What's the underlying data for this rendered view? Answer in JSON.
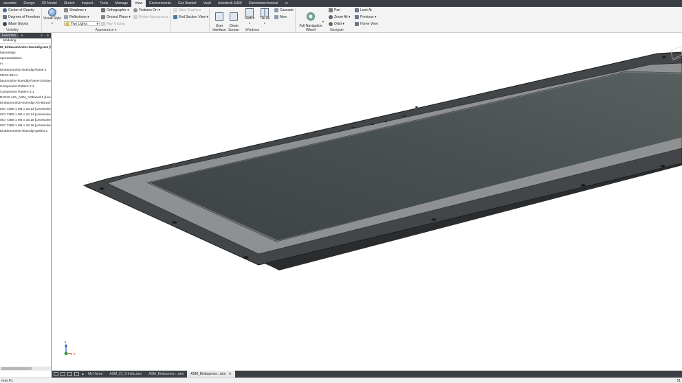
{
  "menu": {
    "tabs": [
      "ssemble",
      "Design",
      "3D Model",
      "Sketch",
      "Inspect",
      "Tools",
      "Manage",
      "View",
      "Environments",
      "Get Started",
      "Vault",
      "Autodesk A360",
      "Electromechanical",
      "▪▾"
    ],
    "active_index": 7
  },
  "ribbon": {
    "visibility": {
      "center_of_gravity": "Center of Gravity",
      "degrees_of_freedom": "Degrees of Freedom",
      "imate_glyphs": "iMate Glyphs",
      "label": "Visibility"
    },
    "appearance": {
      "visual_style": "Visual Style",
      "shadows": "Shadows",
      "reflections": "Reflections",
      "lighting": "Two Lights",
      "orthographic": "Orthographic",
      "ground_plane": "Ground Plane",
      "ray_tracing": "Ray Tracing",
      "textures_on": "Textures On",
      "refine_appearance": "Refine Appearance",
      "slice_graphics": "Slice Graphics",
      "end_section_view": "End Section View",
      "label": "Appearance ▾"
    },
    "windows": {
      "user_interface": "User\nInterface",
      "clean_screen": "Clean\nScreen",
      "switch": "Switch",
      "tile_all": "Tile All",
      "cascade": "Cascade",
      "new": "New",
      "label": "Windows"
    },
    "navigate": {
      "full_nav_wheel": "Full Navigation\nWheel",
      "pan": "Pan",
      "zoom_all": "Zoom All",
      "orbit": "Orbit",
      "look_at": "Look At",
      "previous": "Previous",
      "home_view": "Home View",
      "label": "Navigate"
    }
  },
  "browser": {
    "tab": "Favorites",
    "add": "+",
    "mode": "Modeling",
    "nodes": [
      "M_Einbaumonitor-buendig.iam [l",
      "lationships",
      "epresentations",
      "in",
      "Einbaumonitor-buendig-frame:1",
      "M215-B01:1",
      "baumonitor-buendig-frame-Gehaeuse:",
      "Component Pattern 2:1",
      "Component Pattern 3:1",
      "D1912-A01_ASM_AOboard:1 [Levelof",
      "Einbaumonitor-buendig-AD-Borad-Geh",
      "ISO 7380-1 M4 x 16:13 [Unresolved]",
      "ISO 7380-1 M4 x 16:14 [Unresolved]",
      "ISO 7380-1 M4 x 16:15 [Unresolved]",
      "ISO 7380-1 M4 x 16:16 [Unresolved]",
      "Einbaumonitor-buendig-gasket:1"
    ]
  },
  "viewport": {
    "axis_x": "x",
    "axis_z": "z"
  },
  "doc_tabs": {
    "items": [
      "My Home",
      "ASM_21_5-Indiu.iam",
      "ASM_Einbaumon...iam",
      "ASM_Einbaumon...iam"
    ],
    "active_index": 3,
    "close": "✕"
  },
  "status": {
    "left": "ress F1",
    "right": "51"
  }
}
